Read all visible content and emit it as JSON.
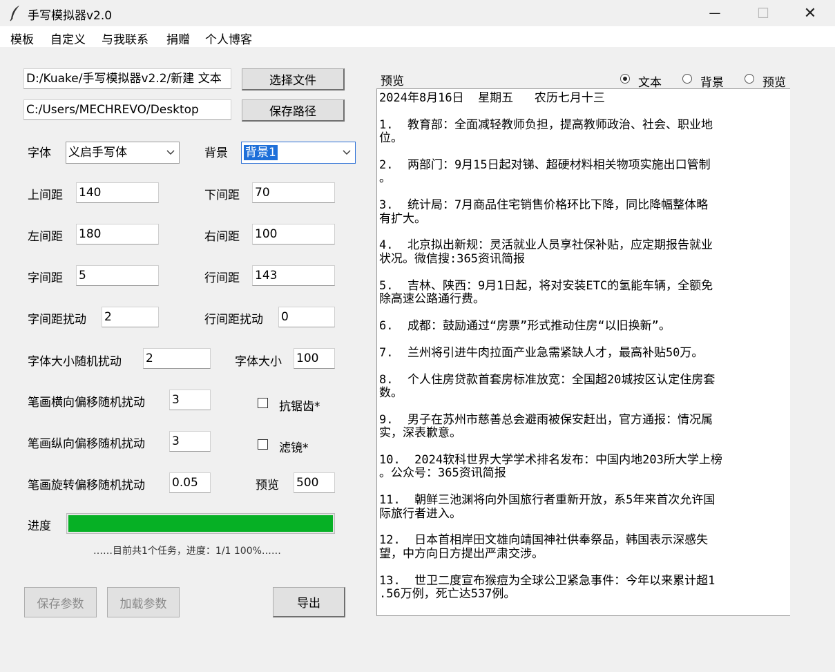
{
  "window": {
    "title": "手写模拟器v2.0",
    "minimize": "—",
    "maximize": "☐",
    "close": "✕"
  },
  "menu": [
    "模板",
    "自定义",
    "与我联系",
    "捐赠",
    "个人博客"
  ],
  "files": {
    "input_path": "D:/Kuake/手写模拟器v2.2/新建 文本",
    "select_button": "选择文件",
    "output_path": "C:/Users/MECHREVO/Desktop",
    "save_path_button": "保存路径"
  },
  "font": {
    "label": "字体",
    "value": "义启手写体"
  },
  "background": {
    "label": "背景",
    "value": "背景1"
  },
  "params": {
    "top_margin": {
      "label": "上间距",
      "value": "140"
    },
    "bottom_margin": {
      "label": "下间距",
      "value": "70"
    },
    "left_margin": {
      "label": "左间距",
      "value": "180"
    },
    "right_margin": {
      "label": "右间距",
      "value": "100"
    },
    "char_spacing": {
      "label": "字间距",
      "value": "5"
    },
    "line_spacing": {
      "label": "行间距",
      "value": "143"
    },
    "char_spacing_jitter": {
      "label": "字间距扰动",
      "value": "2"
    },
    "line_spacing_jitter": {
      "label": "行间距扰动",
      "value": "0"
    },
    "font_size_jitter": {
      "label": "字体大小随机扰动",
      "value": "2"
    },
    "font_size": {
      "label": "字体大小",
      "value": "100"
    },
    "stroke_h_jitter": {
      "label": "笔画横向偏移随机扰动",
      "value": "3"
    },
    "stroke_v_jitter": {
      "label": "笔画纵向偏移随机扰动",
      "value": "3"
    },
    "stroke_rot_jitter": {
      "label": "笔画旋转偏移随机扰动",
      "value": "0.05"
    },
    "preview_size": {
      "label": "预览",
      "value": "500"
    }
  },
  "options": {
    "antialias": "抗锯齿*",
    "filter": "滤镜*"
  },
  "progress": {
    "label": "进度",
    "fraction": 1.0,
    "status": "……目前共1个任务，进度：1/1  100%……"
  },
  "buttons": {
    "save_params": "保存参数",
    "load_params": "加载参数",
    "export": "导出"
  },
  "preview": {
    "label": "预览",
    "mode_options": [
      "文本",
      "背景",
      "预览"
    ],
    "selected_mode": "文本",
    "lines": [
      "2024年8月16日  星期五   农历七月十三",
      "",
      "1.  教育部：全面减轻教师负担，提高教师政治、社会、职业地",
      "位。",
      "",
      "2.  两部门：9月15日起对锑、超硬材料相关物项实施出口管制",
      "。",
      "",
      "3.  统计局：7月商品住宅销售价格环比下降，同比降幅整体略",
      "有扩大。",
      "",
      "4.  北京拟出新规：灵活就业人员享社保补贴，应定期报告就业",
      "状况。微信搜:365资讯简报",
      "",
      "5.  吉林、陕西：9月1日起，将对安装ETC的氢能车辆，全额免",
      "除高速公路通行费。",
      "",
      "6.  成都：鼓励通过“房票”形式推动住房“以旧换新”。",
      "",
      "7.  兰州将引进牛肉拉面产业急需紧缺人才，最高补贴50万。",
      "",
      "8.  个人住房贷款首套房标准放宽：全国超20城按区认定住房套",
      "数。",
      "",
      "9.  男子在苏州市慈善总会避雨被保安赶出，官方通报：情况属",
      "实，深表歉意。",
      "",
      "10.  2024软科世界大学学术排名发布：中国内地203所大学上榜",
      "。公众号：365资讯简报",
      "",
      "11.  朝鲜三池渊将向外国旅行者重新开放，系5年来首次允许国",
      "际旅行者进入。",
      "",
      "12.  日本首相岸田文雄向靖国神社供奉祭品，韩国表示深感失",
      "望，中方向日方提出严肃交涉。",
      "",
      "13.  世卫二度宣布猴痘为全球公卫紧急事件：今年以来累计超1",
      ".56万例，死亡达537例。"
    ]
  },
  "colors": {
    "progress_fill": "#06b025",
    "selection": "#1e6fd9"
  },
  "icons": {
    "app": "feather-icon",
    "combo_arrow": "chevron-down-icon"
  }
}
